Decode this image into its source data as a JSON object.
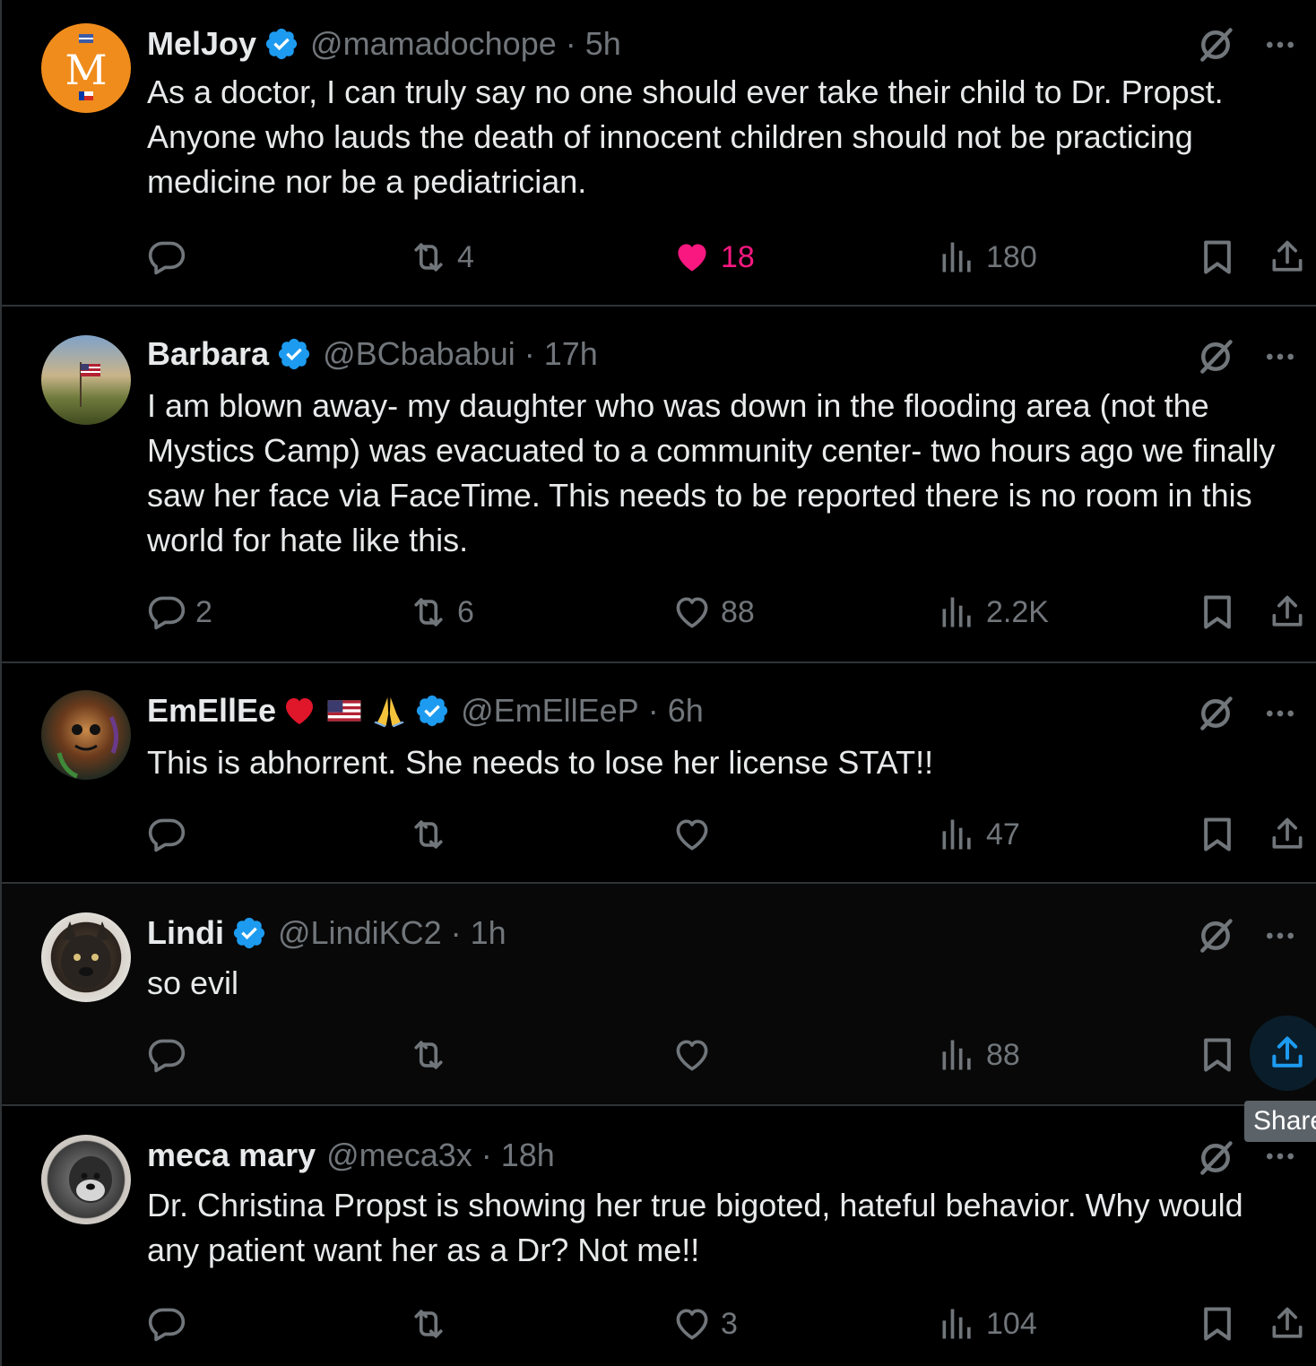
{
  "colors": {
    "accent": "#1d9bf0",
    "like": "#f91880",
    "muted": "#71767b",
    "text": "#e7e9ea",
    "border": "#2f3336"
  },
  "icons": {
    "verified": "verified-badge-icon",
    "grok": "grok-icon",
    "more": "more-icon",
    "reply": "reply-icon",
    "retweet": "retweet-icon",
    "like": "heart-icon",
    "views": "views-icon",
    "bookmark": "bookmark-icon",
    "share": "share-icon"
  },
  "tweets": [
    {
      "name": "MelJoy",
      "handle": "@mamadochope",
      "time": "5h",
      "avatar_letter": "M",
      "text": "As a doctor, I can truly say no one should ever take their child to Dr. Propst. Anyone who lauds the death of innocent children should not be practicing medicine nor be a pediatrician.",
      "replies": "",
      "retweets": "4",
      "likes": "18",
      "views": "180",
      "liked": true
    },
    {
      "name": "Barbara",
      "handle": "@BCbababui",
      "time": "17h",
      "text": "I am blown away- my daughter who was down in the flooding area (not the Mystics Camp) was evacuated to a community center- two hours ago we finally saw her face via FaceTime. This needs to be reported there is no room in this world for hate like this.",
      "replies": "2",
      "retweets": "6",
      "likes": "88",
      "views": "2.2K",
      "liked": false
    },
    {
      "name": "EmEllEe",
      "handle": "@EmEllEeP",
      "time": "6h",
      "text": "This is abhorrent. She needs to lose her license STAT!!",
      "replies": "",
      "retweets": "",
      "likes": "",
      "views": "47",
      "liked": false
    },
    {
      "name": "Lindi",
      "handle": "@LindiKC2",
      "time": "1h",
      "text": "so evil",
      "replies": "",
      "retweets": "",
      "likes": "",
      "views": "88",
      "liked": false
    },
    {
      "name": "meca mary",
      "handle": "@meca3x",
      "time": "18h",
      "text": "Dr. Christina Propst is showing her true bigoted, hateful behavior. Why would any patient want her as a Dr? Not me!!",
      "replies": "",
      "retweets": "",
      "likes": "3",
      "views": "104",
      "liked": false
    }
  ],
  "tooltip": {
    "label": "Share"
  }
}
